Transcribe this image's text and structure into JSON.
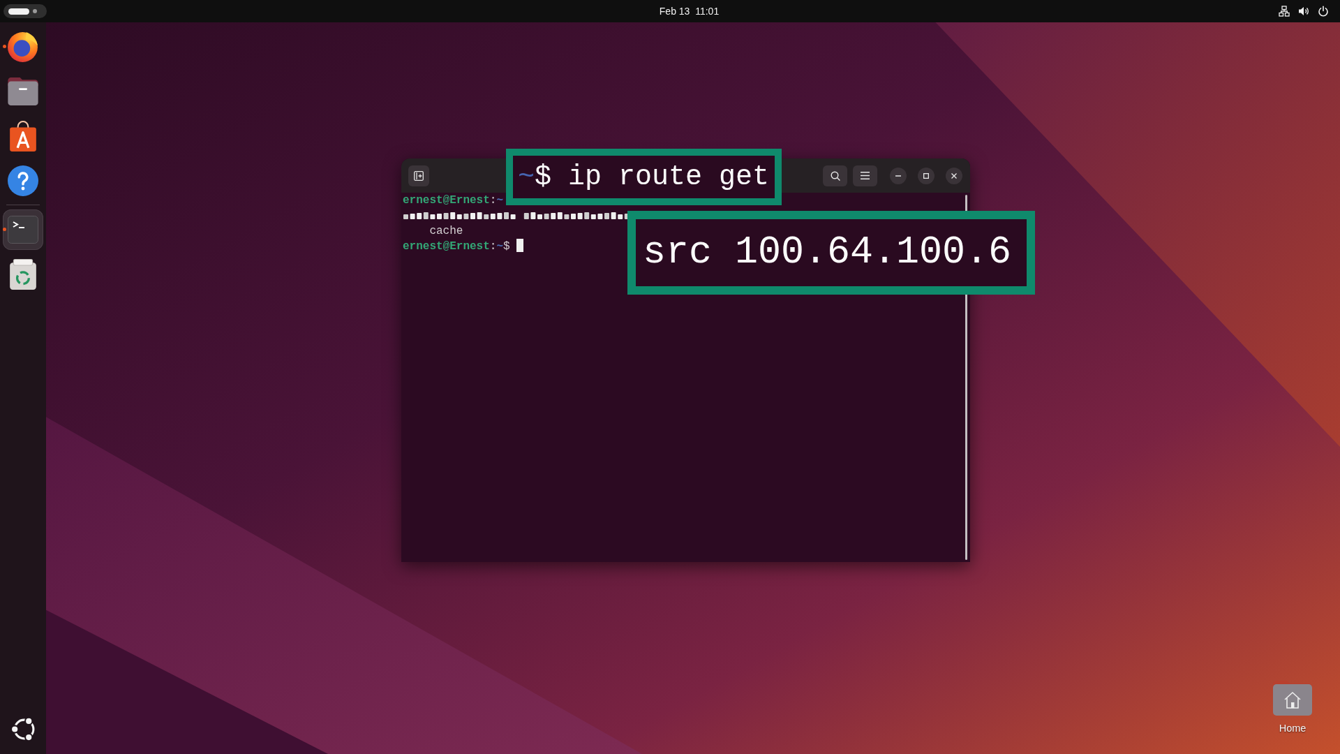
{
  "top_bar": {
    "workspaces": [
      {
        "selected": true
      },
      {
        "selected": false
      }
    ],
    "clock": "Feb 13  11:01"
  },
  "dock": {
    "favorites": [
      {
        "kind": "browser",
        "running": true,
        "selected": false
      },
      {
        "kind": "files",
        "running": false,
        "selected": false
      },
      {
        "kind": "store",
        "running": false,
        "selected": false
      },
      {
        "kind": "help",
        "running": false,
        "selected": false
      }
    ],
    "others": [
      {
        "kind": "terminal",
        "running": true,
        "selected": true
      },
      {
        "kind": "trash",
        "running": false,
        "selected": false
      }
    ]
  },
  "terminal": {
    "lines": [
      {
        "kind": "prompt",
        "user_host": "ernest@Ernest",
        "separator": ":",
        "path": "~",
        "cursor": false
      },
      {
        "kind": "garbled"
      },
      {
        "kind": "indented",
        "text": "cache"
      },
      {
        "kind": "prompt",
        "user_host": "ernest@Ernest",
        "separator": ":",
        "path": "~",
        "symbol": "$",
        "cursor": true
      }
    ]
  },
  "callouts": [
    {
      "path": "~",
      "text": "$ ip route get"
    },
    {
      "text": "src 100.64.100.6"
    }
  ],
  "desktop_icons": [
    {
      "label": "Home"
    }
  ]
}
